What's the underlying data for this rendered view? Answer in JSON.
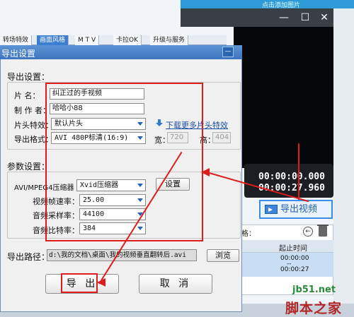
{
  "bg_app": {
    "top_hint": "点击添加图片",
    "tabs": [
      "转场特效",
      "画面风格",
      "M T V",
      "卡拉OK",
      "升级与服务"
    ],
    "active_tab_index": 1,
    "timecode_current": "00:00:00.000",
    "timecode_total": "00:00:27.960",
    "export_video_label": "导出视频",
    "list_label": "格：",
    "list_column_start": "起止时间",
    "list_row_time_start": "00:00:00",
    "list_row_dash": "--",
    "list_row_time_end": "00:00:27",
    "window_buttons": [
      "—",
      "☐",
      "✕"
    ]
  },
  "dialog": {
    "title": "导出设置",
    "minimize_glyph": "—",
    "export_settings_section": "导出设置：",
    "title_label": "片    名：",
    "title_value": "纠正过的手视频",
    "author_label": "制 作 者：",
    "author_value": "哈哈小88",
    "intro_label": "片头特效：",
    "intro_value": "默认片头",
    "download_link": "下载更多片头特效",
    "format_label": "导出格式：",
    "format_value": "AVI 480P标清(16:9)",
    "width_label": "宽：",
    "width_value": "720",
    "height_label": "高：",
    "height_value": "404",
    "params_section": "参数设置：",
    "codec_label": "AVI/MPEG4压缩器",
    "codec_value": "Xvid压缩器",
    "settings_button": "设置",
    "framerate_label": "视频帧速率：",
    "framerate_value": "25.00",
    "samplerate_label": "音频采样率：",
    "samplerate_value": "44100",
    "bitrate_label": "音频比特率：",
    "bitrate_value": "384",
    "path_label": "导出路径：",
    "path_value": "d:\\我的文档\\桌面\\我的视频垂直翻转后.avi",
    "browse_button": "浏览",
    "export_button": "导 出",
    "cancel_button": "取 消"
  },
  "watermark": {
    "site": "jb51.net",
    "name": "脚本之家"
  },
  "colors": {
    "annotation_red": "#e01b1b",
    "dialog_title_blue": "#3d74bf",
    "accent_blue": "#3d8ee8"
  }
}
